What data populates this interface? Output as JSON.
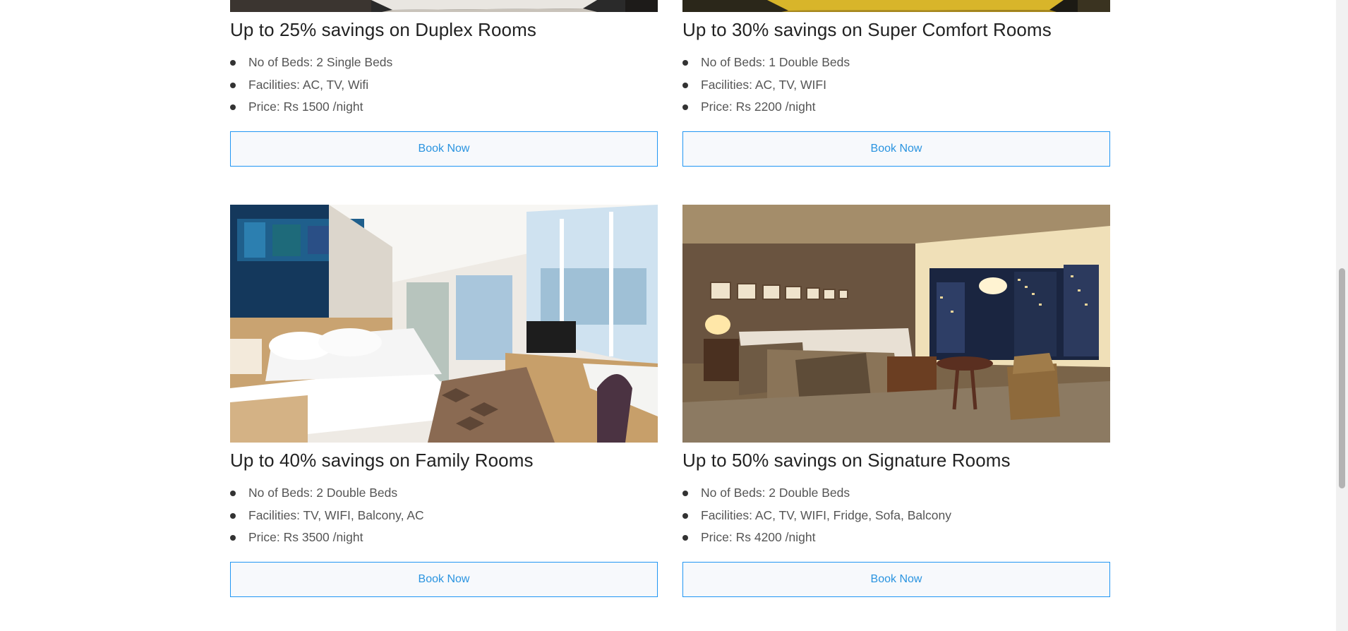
{
  "rooms": [
    {
      "title": "Up to 25% savings on Duplex Rooms",
      "features": [
        "No of Beds: 2 Single Beds",
        "Facilities: AC, TV, Wifi",
        "Price: Rs 1500 /night"
      ],
      "button_label": "Book Now",
      "image_icon": "duplex-room-photo"
    },
    {
      "title": "Up to 30% savings on Super Comfort Rooms",
      "features": [
        "No of Beds: 1 Double Beds",
        "Facilities: AC, TV, WIFI",
        "Price: Rs 2200 /night"
      ],
      "button_label": "Book Now",
      "image_icon": "super-comfort-room-photo"
    },
    {
      "title": "Up to 40% savings on Family Rooms",
      "features": [
        "No of Beds: 2 Double Beds",
        "Facilities: TV, WIFI, Balcony, AC",
        "Price: Rs 3500 /night"
      ],
      "button_label": "Book Now",
      "image_icon": "family-room-photo"
    },
    {
      "title": "Up to 50% savings on Signature Rooms",
      "features": [
        "No of Beds: 2 Double Beds",
        "Facilities: AC, TV, WIFI, Fridge, Sofa, Balcony",
        "Price: Rs 4200 /night"
      ],
      "button_label": "Book Now",
      "image_icon": "signature-room-photo"
    }
  ],
  "colors": {
    "accent": "#2196f3",
    "button_bg": "#f7f9fc",
    "title": "#222222",
    "text": "#555555"
  }
}
